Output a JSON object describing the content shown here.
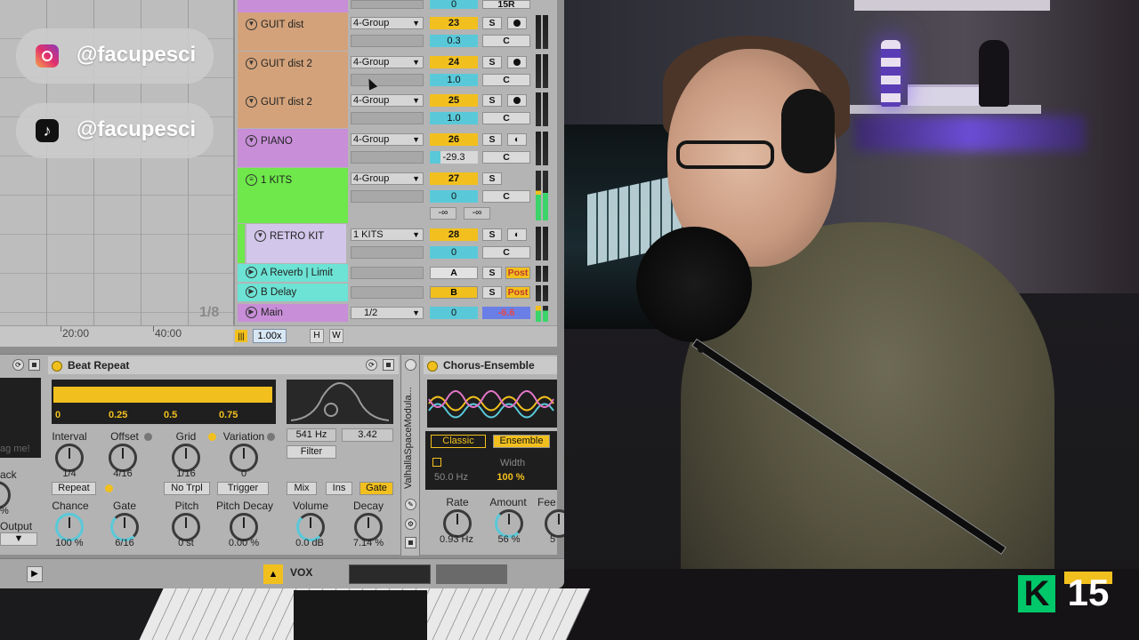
{
  "social": {
    "instagram_handle": "@facupesci",
    "tiktok_handle": "@facupesci"
  },
  "arrangement": {
    "loop_count": "1/8",
    "ruler_marks": [
      "20:00",
      "40:00"
    ]
  },
  "mixer": {
    "top_partial": {
      "num": "0",
      "label": "15R"
    },
    "tracks": [
      {
        "name": "GUIT dist",
        "color": "#d3a27a",
        "routing": "4-Group",
        "number": "23",
        "volume": "0.3",
        "solo": "S",
        "cue": "C"
      },
      {
        "name": "GUIT dist 2",
        "color": "#d3a27a",
        "routing": "4-Group",
        "number": "24",
        "volume": "1.0",
        "solo": "S",
        "cue": "C"
      },
      {
        "name": "GUIT dist 2",
        "color": "#d3a27a",
        "routing": "4-Group",
        "number": "25",
        "volume": "1.0",
        "solo": "S",
        "cue": "C"
      },
      {
        "name": "PIANO",
        "color": "#c88ed8",
        "routing": "4-Group",
        "number": "26",
        "volume": "-29.3",
        "solo": "S",
        "cue": "C"
      },
      {
        "name": "1 KITS",
        "color": "#6ee84a",
        "routing": "4-Group",
        "number": "27",
        "volume": "0",
        "solo": "S",
        "cue": "C",
        "neg_inf_left": "-∞",
        "neg_inf_right": "-∞"
      },
      {
        "name": "RETRO KIT",
        "color": "#d2c7ea",
        "routing": "1 KITS",
        "number": "28",
        "volume": "0",
        "solo": "S",
        "cue": "C"
      }
    ],
    "returns": [
      {
        "name": "A Reverb | Limit",
        "color": "#6ce3d4",
        "letter": "A",
        "solo": "S",
        "post": "Post"
      },
      {
        "name": "B Delay",
        "color": "#6ce3d4",
        "letter": "B",
        "solo": "S",
        "post": "Post"
      }
    ],
    "main": {
      "name": "Main",
      "color": "#c88ed8",
      "routing": "1/2",
      "volume": "0",
      "db": "-6.6"
    }
  },
  "session_bar": {
    "zoom": "1.00x",
    "h": "H",
    "w": "W"
  },
  "beat_repeat": {
    "title": "Beat Repeat",
    "grid_labels": [
      "0",
      "0.25",
      "0.5",
      "0.75"
    ],
    "knobs_row1": [
      {
        "label": "Interval",
        "value": "1/4"
      },
      {
        "label": "Offset",
        "value": "4/16"
      },
      {
        "label": "Grid",
        "value": "1/16"
      },
      {
        "label": "Variation",
        "value": "0"
      }
    ],
    "buttons_row1": {
      "repeat": "Repeat",
      "no_trpl": "No Trpl",
      "trigger": "Trigger"
    },
    "knobs_row2": [
      {
        "label": "Chance",
        "value": "100 %"
      },
      {
        "label": "Gate",
        "value": "6/16"
      },
      {
        "label": "Pitch",
        "value": "0 st"
      },
      {
        "label": "Pitch Decay",
        "value": "0.00 %"
      }
    ],
    "filter": {
      "freq": "541 Hz",
      "width": "3.42",
      "label": "Filter"
    },
    "mix_modes": [
      "Mix",
      "Ins",
      "Gate"
    ],
    "volume": {
      "label": "Volume",
      "value": "0.0 dB"
    },
    "decay": {
      "label": "Decay",
      "value": "7.14 %"
    }
  },
  "left_device": {
    "drag_hint": "ag me!",
    "back_label": "ack",
    "pct": "%",
    "output_label": "Output"
  },
  "valhalla": {
    "label": "ValhallaSpaceModula..."
  },
  "chorus": {
    "title": "Chorus-Ensemble",
    "modes": [
      "Classic",
      "Ensemble"
    ],
    "hz": "50.0 Hz",
    "width_label": "Width",
    "width_value": "100 %",
    "rate": {
      "label": "Rate",
      "value": "0.93 Hz"
    },
    "amount": {
      "label": "Amount",
      "value": "56 %"
    },
    "fee_label": "Fee",
    "fee_value": "5"
  },
  "bottom_bar": {
    "track_name": "VOX"
  },
  "channel_logo": {
    "letter": "K",
    "number": "15"
  }
}
